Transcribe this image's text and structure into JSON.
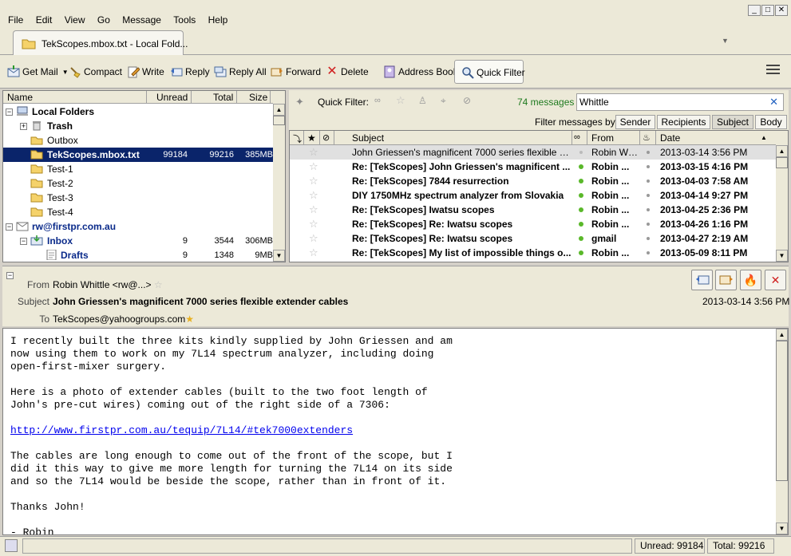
{
  "menu": [
    "File",
    "Edit",
    "View",
    "Go",
    "Message",
    "Tools",
    "Help"
  ],
  "tab": {
    "title": "TekScopes.mbox.txt - Local Fold..."
  },
  "toolbar": {
    "get_mail": "Get Mail",
    "compact": "Compact",
    "write": "Write",
    "reply": "Reply",
    "reply_all": "Reply All",
    "forward": "Forward",
    "delete": "Delete",
    "address_book": "Address Book",
    "quick_filter": "Quick Filter"
  },
  "folder_pane": {
    "headers": {
      "name": "Name",
      "unread": "Unread",
      "total": "Total",
      "size": "Size"
    },
    "rows": [
      {
        "name": "Local Folders",
        "unread": "",
        "total": "",
        "size": ""
      },
      {
        "name": "Trash",
        "unread": "",
        "total": "",
        "size": ""
      },
      {
        "name": "Outbox",
        "unread": "",
        "total": "",
        "size": ""
      },
      {
        "name": "TekScopes.mbox.txt",
        "unread": "99184",
        "total": "99216",
        "size": "385MB"
      },
      {
        "name": "Test-1",
        "unread": "",
        "total": "",
        "size": ""
      },
      {
        "name": "Test-2",
        "unread": "",
        "total": "",
        "size": ""
      },
      {
        "name": "Test-3",
        "unread": "",
        "total": "",
        "size": ""
      },
      {
        "name": "Test-4",
        "unread": "",
        "total": "",
        "size": ""
      },
      {
        "name": "rw@firstpr.com.au",
        "unread": "",
        "total": "",
        "size": ""
      },
      {
        "name": "Inbox",
        "unread": "9",
        "total": "3544",
        "size": "306MB"
      },
      {
        "name": "Drafts",
        "unread": "9",
        "total": "1348",
        "size": "9MB"
      }
    ]
  },
  "quick_filter": {
    "label": "Quick Filter:",
    "count": "74 messages",
    "search_value": "Whittle",
    "filter_by_label": "Filter messages by:",
    "filter_buttons": [
      "Sender",
      "Recipients",
      "Subject",
      "Body"
    ]
  },
  "thread_pane": {
    "headers": {
      "subject": "Subject",
      "from": "From",
      "date": "Date"
    },
    "rows": [
      {
        "subject": "John Griessen's magnificent 7000 series flexible extend...",
        "from": "Robin Wh...",
        "date": "2013-03-14 3:56 PM",
        "unread": false
      },
      {
        "subject": "Re: [TekScopes] John Griessen's magnificent ...",
        "from": "Robin ...",
        "date": "2013-03-15 4:16 PM",
        "unread": true
      },
      {
        "subject": "Re: [TekScopes] 7844 resurrection",
        "from": "Robin ...",
        "date": "2013-04-03 7:58 AM",
        "unread": true
      },
      {
        "subject": "DIY 1750MHz spectrum analyzer from Slovakia",
        "from": "Robin ...",
        "date": "2013-04-14 9:27 PM",
        "unread": true
      },
      {
        "subject": "Re: [TekScopes] Iwatsu scopes",
        "from": "Robin ...",
        "date": "2013-04-25 2:36 PM",
        "unread": true
      },
      {
        "subject": "Re: [TekScopes] Re: Iwatsu scopes",
        "from": "Robin ...",
        "date": "2013-04-26 1:16 PM",
        "unread": true
      },
      {
        "subject": "Re: [TekScopes] Re: Iwatsu scopes",
        "from": "gmail",
        "date": "2013-04-27 2:19 AM",
        "unread": true
      },
      {
        "subject": "Re: [TekScopes] My list of impossible things o...",
        "from": "Robin ...",
        "date": "2013-05-09 8:11 PM",
        "unread": true
      }
    ]
  },
  "message_header": {
    "from_label": "From",
    "from_value": "Robin Whittle <rw@...>",
    "subject_label": "Subject",
    "subject_value": "John Griessen's magnificent 7000 series flexible extender cables",
    "to_label": "To",
    "to_value": "TekScopes@yahoogroups.com",
    "date": "2013-03-14 3:56 PM"
  },
  "message_body": {
    "para1": "I recently built the three kits kindly supplied by John Griessen and am\nnow using them to work on my 7L14 spectrum analyzer, including doing\nopen-first-mixer surgery.\n\nHere is a photo of extender cables (built to the two foot length of\nJohn's pre-cut wires) coming out of the right side of a 7306:\n\n",
    "link": "http://www.firstpr.com.au/tequip/7L14/#tek7000extenders",
    "para2": "\n\nThe cables are long enough to come out of the front of the scope, but I\ndid it this way to give me more length for turning the 7L14 on its side\nand so the 7L14 would be beside the scope, rather than in front of it.\n\nThanks John!\n\n- Robin"
  },
  "status": {
    "unread": "Unread: 99184",
    "total": "Total: 99216"
  }
}
